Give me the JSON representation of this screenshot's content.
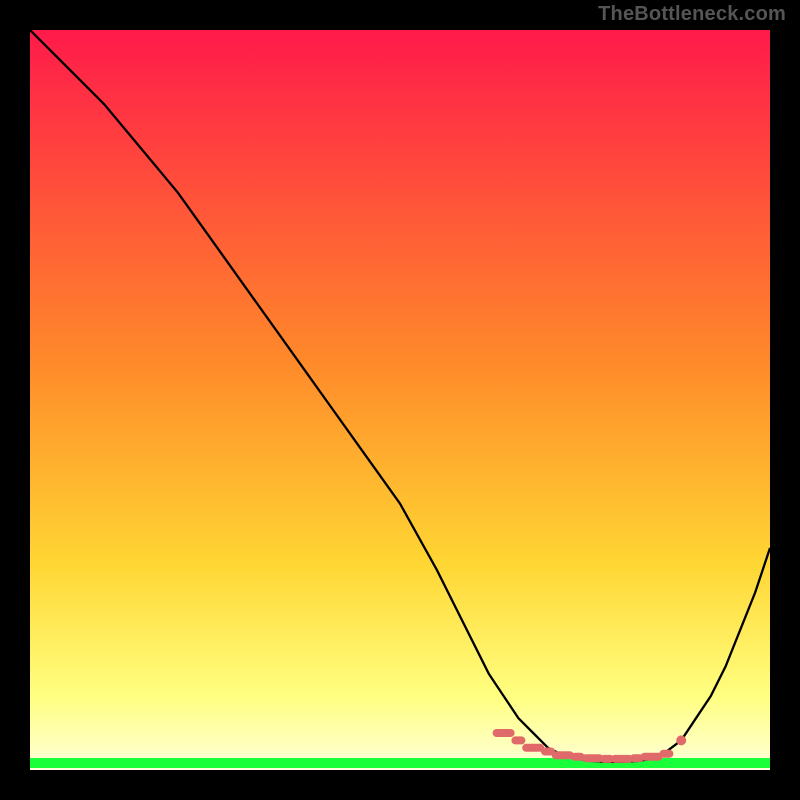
{
  "watermark": "TheBottleneck.com",
  "chart_data": {
    "type": "line",
    "title": "",
    "xlabel": "",
    "ylabel": "",
    "xlim": [
      0,
      100
    ],
    "ylim": [
      0,
      100
    ],
    "x": [
      0,
      5,
      10,
      15,
      20,
      25,
      30,
      35,
      40,
      45,
      50,
      55,
      58,
      60,
      62,
      64,
      66,
      68,
      70,
      72,
      74,
      76,
      78,
      80,
      82,
      84,
      86,
      88,
      90,
      92,
      94,
      96,
      98,
      100
    ],
    "values": [
      100,
      95,
      90,
      84,
      78,
      71,
      64,
      57,
      50,
      43,
      36,
      27,
      21,
      17,
      13,
      10,
      7,
      5,
      3,
      2,
      1.5,
      1.2,
      1.1,
      1.1,
      1.2,
      1.5,
      2.5,
      4,
      7,
      10,
      14,
      19,
      24,
      30
    ],
    "optimal_region_x": [
      64,
      66,
      68,
      70,
      72,
      74,
      76,
      78,
      80,
      82,
      84,
      86
    ],
    "optimal_region_y": [
      5,
      4,
      3,
      2.5,
      2,
      1.8,
      1.6,
      1.5,
      1.5,
      1.6,
      1.8,
      2.2
    ],
    "gradient": {
      "top": "#ff1a4a",
      "mid": "#ffd633",
      "low": "#ffff80",
      "green": "#19ff3a"
    }
  }
}
